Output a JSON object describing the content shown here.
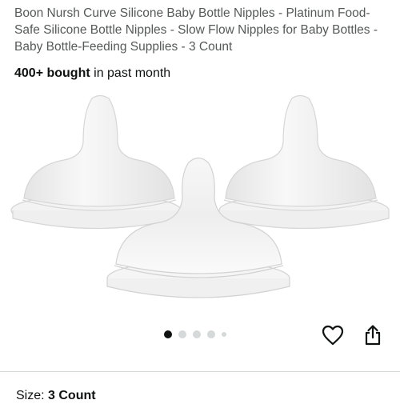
{
  "product": {
    "title": "Boon Nursh Curve Silicone Baby Bottle Nipples - Platinum Food-Safe Silicone Bottle Nipples - Slow Flow Nipples for Baby Bottles - Baby Bottle-Feeding Supplies - 3 Count",
    "bought_count": "400+ bought",
    "bought_suffix": " in past month"
  },
  "carousel": {
    "total_images": 5,
    "active_index": 0
  },
  "icons": {
    "wishlist": "heart-icon",
    "share": "share-icon"
  },
  "size": {
    "label": "Size:",
    "value": "3 Count"
  },
  "colors": {
    "text": "#0F1111",
    "muted": "#565959",
    "dot_inactive": "#D5D9D9"
  }
}
